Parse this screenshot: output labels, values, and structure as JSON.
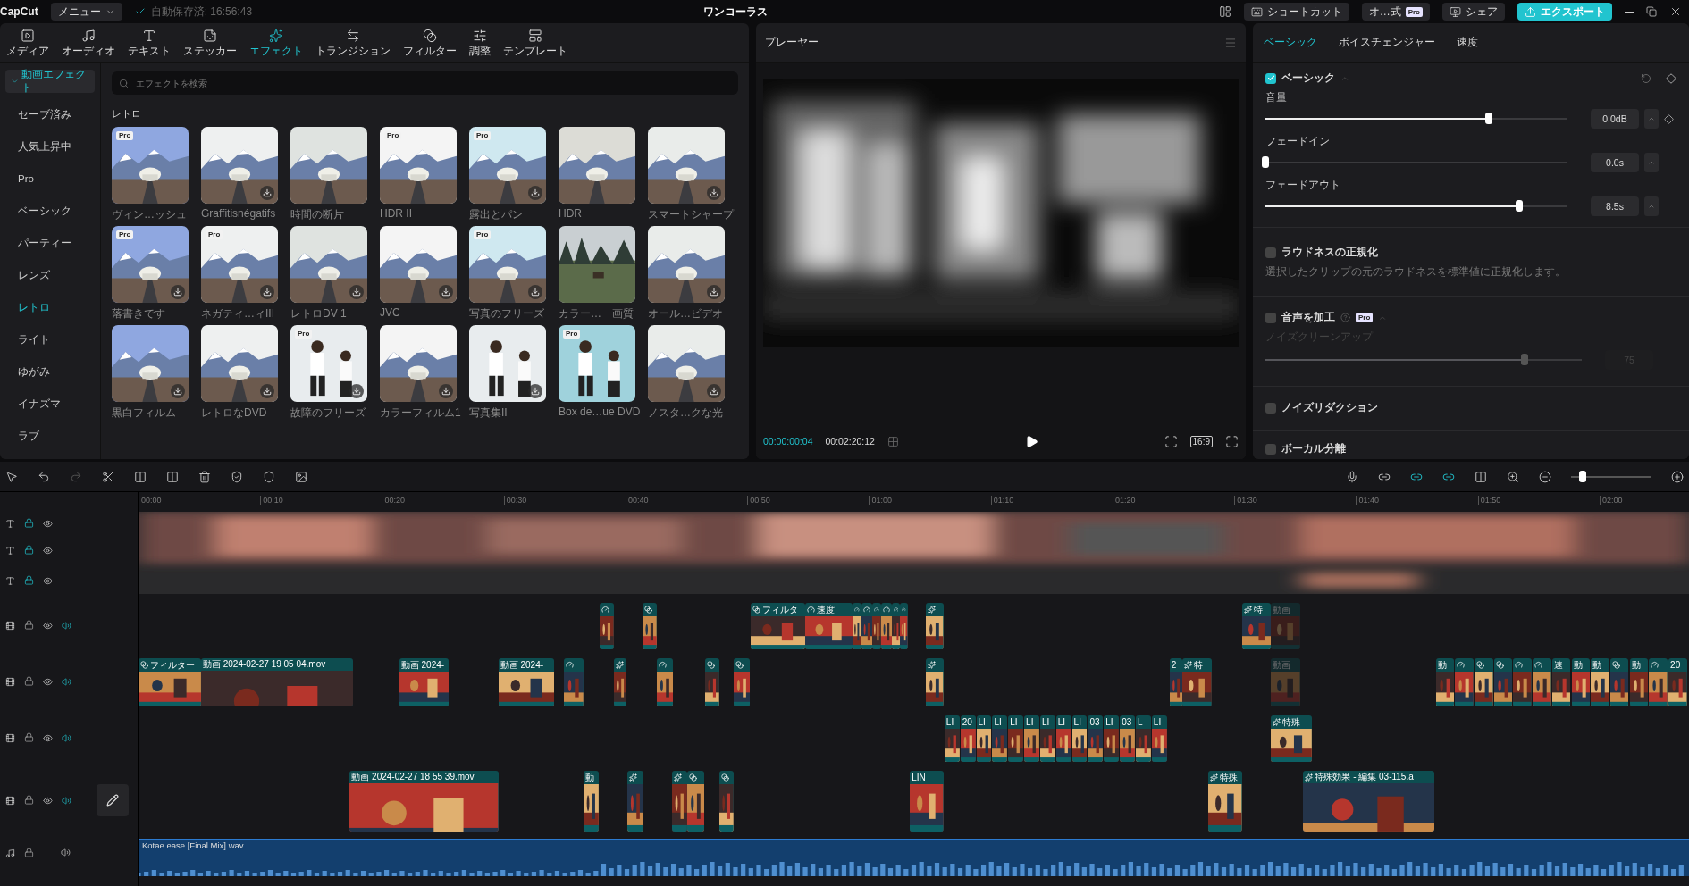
{
  "topbar": {
    "app": "CapCut",
    "menu": "メニュー",
    "autosave": "自動保存済: 16:56:43",
    "title": "ワンコーラス",
    "shortcut": "ショートカット",
    "account": "オ…式",
    "account_badge": "Pro",
    "share": "シェア",
    "export": "エクスポート"
  },
  "toolbar_tabs": [
    {
      "label": "メディア",
      "kind": "media",
      "selected": false
    },
    {
      "label": "オーディオ",
      "kind": "audio",
      "selected": false
    },
    {
      "label": "テキスト",
      "kind": "text",
      "selected": false
    },
    {
      "label": "ステッカー",
      "kind": "sticker",
      "selected": false
    },
    {
      "label": "エフェクト",
      "kind": "effect",
      "selected": true
    },
    {
      "label": "トランジション",
      "kind": "transition",
      "selected": false
    },
    {
      "label": "フィルター",
      "kind": "filter",
      "selected": false
    },
    {
      "label": "調整",
      "kind": "adjust",
      "selected": false
    },
    {
      "label": "テンプレート",
      "kind": "template",
      "selected": false
    }
  ],
  "sidebar": {
    "header": {
      "label": "動画エフェクト",
      "expanded": true
    },
    "items": [
      {
        "label": "セーブ済み",
        "selected": false
      },
      {
        "label": "人気上昇中",
        "selected": false
      },
      {
        "label": "Pro",
        "selected": false
      },
      {
        "label": "ベーシック",
        "selected": false
      },
      {
        "label": "パーティー",
        "selected": false
      },
      {
        "label": "レンズ",
        "selected": false
      },
      {
        "label": "レトロ",
        "selected": true
      },
      {
        "label": "ライト",
        "selected": false
      },
      {
        "label": "ゆがみ",
        "selected": false
      },
      {
        "label": "イナズマ",
        "selected": false
      },
      {
        "label": "ラブ",
        "selected": false
      }
    ]
  },
  "search": {
    "placeholder": "エフェクトを検索"
  },
  "section_title": "レトロ",
  "effects": [
    {
      "label": "ヴィン…ッシュ",
      "badge": "Pro",
      "downloadable": false
    },
    {
      "label": "Graffitisnégatifs",
      "downloadable": true
    },
    {
      "label": "時間の断片",
      "downloadable": false
    },
    {
      "label": "HDR II",
      "badge": "Pro",
      "downloadable": false
    },
    {
      "label": "露出とパン",
      "badge": "Pro",
      "downloadable": true
    },
    {
      "label": "HDR",
      "downloadable": false
    },
    {
      "label": "スマートシャープ",
      "downloadable": true
    },
    {
      "label": "落書きです",
      "badge": "Pro",
      "downloadable": true
    },
    {
      "label": "ネガティ…ィIII",
      "badge": "Pro",
      "downloadable": true
    },
    {
      "label": "レトロDV 1",
      "downloadable": true
    },
    {
      "label": "JVC",
      "downloadable": true
    },
    {
      "label": "写真のフリーズ",
      "badge": "Pro",
      "downloadable": true
    },
    {
      "label": "カラー…一画質",
      "downloadable": false
    },
    {
      "label": "オール…ビデオ",
      "downloadable": true
    },
    {
      "label": "黒白フィルム",
      "downloadable": true
    },
    {
      "label": "レトロなDVD",
      "downloadable": true
    },
    {
      "label": "故障のフリーズ",
      "badge": "Pro",
      "downloadable": true
    },
    {
      "label": "カラーフィルム1",
      "downloadable": true
    },
    {
      "label": "写真集II",
      "downloadable": true
    },
    {
      "label": "Box de…ue DVD",
      "badge": "Pro",
      "downloadable": false
    },
    {
      "label": "ノスタ…クな光",
      "downloadable": true
    }
  ],
  "player": {
    "title": "プレーヤー",
    "current_time": "00:00:00:04",
    "total_time": "00:02:20:12",
    "ratio": "16:9"
  },
  "inspector": {
    "tabs": [
      {
        "label": "ベーシック",
        "selected": true
      },
      {
        "label": "ボイスチェンジャー",
        "selected": false
      },
      {
        "label": "速度",
        "selected": false
      }
    ],
    "basic": {
      "label": "ベーシック",
      "checked": true
    },
    "sliders": [
      {
        "label": "音量",
        "level": 0.74,
        "value": "0.0dB",
        "keyframe": true
      },
      {
        "label": "フェードイン",
        "level": 0,
        "value": "0.0s",
        "keyframe": false
      },
      {
        "label": "フェードアウト",
        "level": 0.84,
        "value": "8.5s",
        "keyframe": false
      }
    ],
    "loudness": {
      "label": "ラウドネスの正規化",
      "checked": false,
      "description": "選択したクリップの元のラウドネスを標準値に正規化します。"
    },
    "enhance": {
      "label": "音声を加工",
      "checked": false,
      "badge": "Pro",
      "slider": {
        "label": "ノイズクリーンアップ",
        "level": 0.82,
        "value": "75",
        "disabled": true
      }
    },
    "noise": {
      "label": "ノイズリダクション",
      "checked": false
    },
    "vocal": {
      "label": "ボーカル分離",
      "checked": false
    }
  },
  "timeline": {
    "zoom": {
      "level": 0.1
    },
    "ruler": [
      "00:00",
      "00:10",
      "00:20",
      "00:30",
      "00:40",
      "00:50",
      "01:00",
      "01:10",
      "01:20",
      "01:30",
      "01:40",
      "01:50",
      "02:00"
    ],
    "text_tracks": [
      {
        "locked": true
      },
      {
        "locked": true
      },
      {
        "locked": true
      }
    ],
    "tracks": [
      {
        "locked": false,
        "clips": [
          {
            "kind": "speed"
          },
          {
            "kind": "filter"
          },
          {
            "kind": "filter",
            "label": "フィルタ"
          },
          {
            "kind": "speed",
            "label": "速度"
          },
          {
            "kind": "speed"
          },
          {
            "kind": "speed"
          },
          {
            "kind": "speed"
          },
          {
            "kind": "speed"
          },
          {
            "kind": "speed"
          },
          {
            "kind": "speed"
          },
          {
            "kind": "effect"
          },
          {
            "kind": "effect",
            "label": "特"
          },
          {
            "kind": "video",
            "label": "動画",
            "faded": true
          }
        ]
      },
      {
        "locked": false,
        "clips": [
          {
            "kind": "filter",
            "label": "フィルター"
          },
          {
            "kind": "video",
            "label": "動画 2024-02-27 19 05 04.mov"
          },
          {
            "kind": "video",
            "label": "動画 2024-"
          },
          {
            "kind": "video",
            "label": "動画 2024-"
          },
          {
            "kind": "speed"
          },
          {
            "kind": "effect"
          },
          {
            "kind": "speed"
          },
          {
            "kind": "filter"
          },
          {
            "kind": "filter"
          },
          {
            "kind": "effect"
          },
          {
            "kind": "video",
            "label": "2"
          },
          {
            "kind": "effect",
            "label": "特"
          },
          {
            "kind": "video",
            "label": "動画",
            "faded": true
          },
          {
            "kind": "video",
            "label": "動"
          },
          {
            "kind": "speed"
          },
          {
            "kind": "filter"
          },
          {
            "kind": "filter"
          },
          {
            "kind": "speed"
          },
          {
            "kind": "speed"
          },
          {
            "kind": "video",
            "label": "速"
          },
          {
            "kind": "video",
            "label": "動"
          },
          {
            "kind": "video",
            "label": "動"
          },
          {
            "kind": "filter"
          },
          {
            "kind": "video",
            "label": "動"
          },
          {
            "kind": "speed"
          },
          {
            "kind": "video",
            "label": "20"
          }
        ]
      },
      {
        "locked": false,
        "clips": [
          {
            "kind": "video",
            "label": "LI"
          },
          {
            "kind": "video",
            "label": "20"
          },
          {
            "kind": "video",
            "label": "LI"
          },
          {
            "kind": "video",
            "label": "LI"
          },
          {
            "kind": "video",
            "label": "LI"
          },
          {
            "kind": "video",
            "label": "LI"
          },
          {
            "kind": "video",
            "label": "LI"
          },
          {
            "kind": "video",
            "label": "LI"
          },
          {
            "kind": "video",
            "label": "LI"
          },
          {
            "kind": "video",
            "label": "03"
          },
          {
            "kind": "video",
            "label": "LI"
          },
          {
            "kind": "video",
            "label": "03"
          },
          {
            "kind": "video",
            "label": "L"
          },
          {
            "kind": "video",
            "label": "LI"
          },
          {
            "kind": "effect",
            "label": "特殊"
          }
        ]
      },
      {
        "locked": false,
        "clips": [
          {
            "kind": "video",
            "label": "動画 2024-02-27 18 55 39.mov"
          },
          {
            "kind": "video",
            "label": "動"
          },
          {
            "kind": "effect"
          },
          {
            "kind": "effect"
          },
          {
            "kind": "filter"
          },
          {
            "kind": "filter"
          },
          {
            "kind": "video",
            "label": "LIN"
          },
          {
            "kind": "effect",
            "label": "特殊"
          },
          {
            "kind": "effect",
            "label": "特殊効果 - 編集  03-115.a"
          }
        ]
      }
    ],
    "audio": {
      "label": "Kotae ease [Final Mix].wav",
      "locked": false
    }
  }
}
